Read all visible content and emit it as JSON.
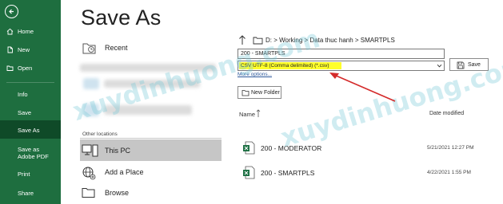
{
  "title": "Save As",
  "nav": {
    "items": [
      {
        "label": "Home"
      },
      {
        "label": "New"
      },
      {
        "label": "Open"
      },
      {
        "label": "Info"
      },
      {
        "label": "Save"
      },
      {
        "label": "Save As"
      },
      {
        "label": "Save as Adobe PDF"
      },
      {
        "label": "Print"
      },
      {
        "label": "Share"
      }
    ]
  },
  "locations": {
    "recent": "Recent",
    "other_locations": "Other locations",
    "this_pc": "This PC",
    "add_place": "Add a Place",
    "browse": "Browse"
  },
  "path": {
    "text": "D: > Working > Data thuc hanh > SMARTPLS"
  },
  "save_form": {
    "filename": "200 - SMARTPLS",
    "filetype": "CSV UTF-8 (Comma delimited) (*.csv)",
    "save_label": "Save",
    "more_options": "More options...",
    "new_folder": "New Folder"
  },
  "file_list": {
    "col_name": "Name",
    "col_date": "Date modified",
    "files": [
      {
        "name": "200 - MODERATOR",
        "date": "5/21/2021 12:27 PM"
      },
      {
        "name": "200 - SMARTPLS",
        "date": "4/22/2021 1:55 PM"
      }
    ]
  },
  "watermark": "xuydinhuong.com",
  "colors": {
    "nav_bg": "#1e6e3f",
    "nav_active": "#0f4a28",
    "highlight": "#ffff2a",
    "arrow": "#d42a2a",
    "link": "#2b579a",
    "excel_green": "#1d7044"
  }
}
